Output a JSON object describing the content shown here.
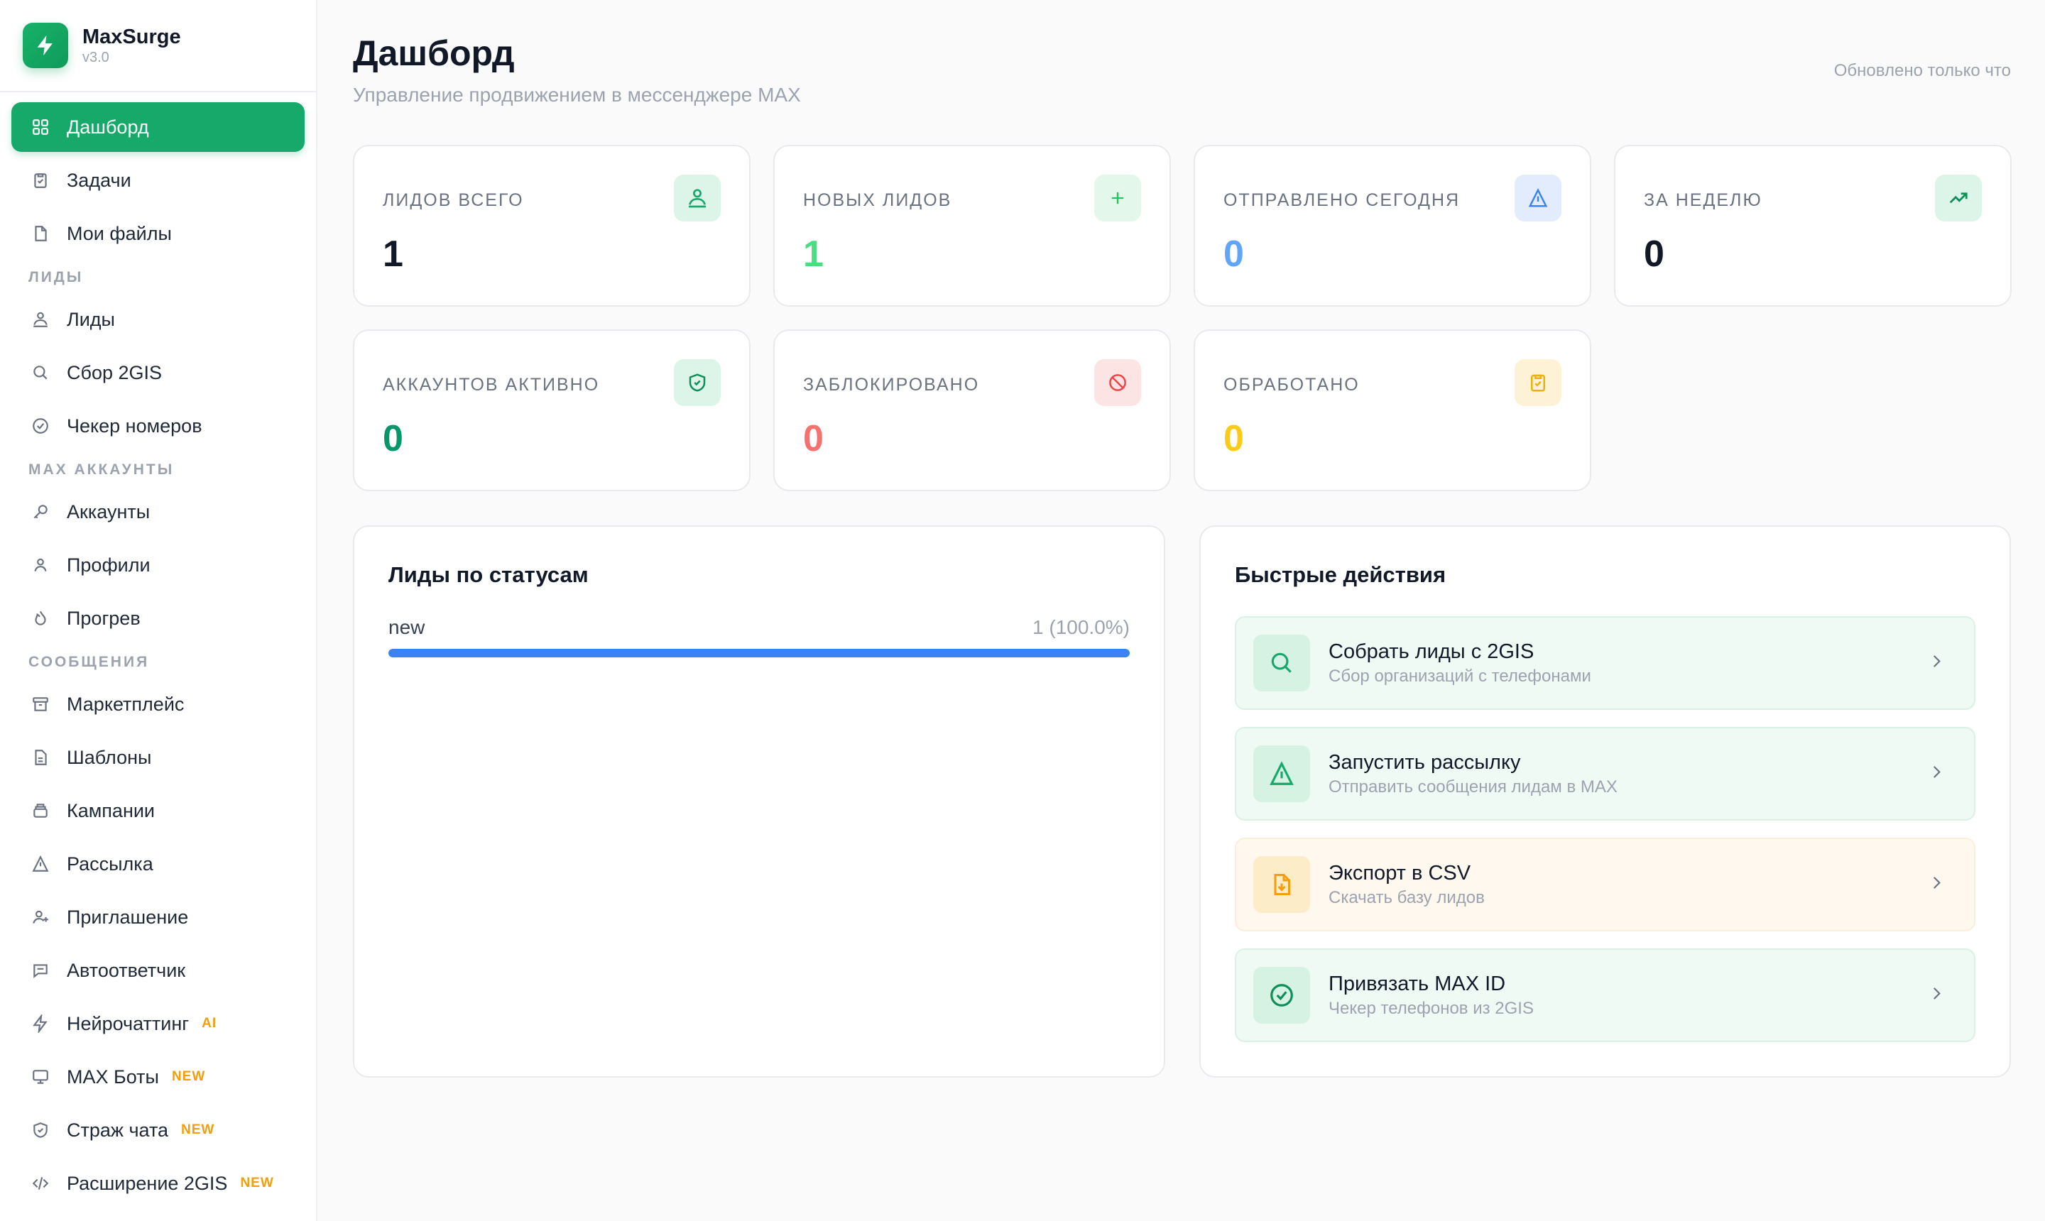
{
  "brand": {
    "name": "MaxSurge",
    "version": "v3.0"
  },
  "sidebar": {
    "items": [
      {
        "label": "Дашборд"
      },
      {
        "label": "Задачи"
      },
      {
        "label": "Мои файлы"
      }
    ],
    "sections": [
      {
        "title": "ЛИДЫ",
        "items": [
          {
            "label": "Лиды"
          },
          {
            "label": "Сбор 2GIS"
          },
          {
            "label": "Чекер номеров"
          }
        ]
      },
      {
        "title": "MAX АККАУНТЫ",
        "items": [
          {
            "label": "Аккаунты"
          },
          {
            "label": "Профили"
          },
          {
            "label": "Прогрев"
          }
        ]
      },
      {
        "title": "СООБЩЕНИЯ",
        "items": [
          {
            "label": "Маркетплейс"
          },
          {
            "label": "Шаблоны"
          },
          {
            "label": "Кампании"
          },
          {
            "label": "Рассылка"
          },
          {
            "label": "Приглашение"
          },
          {
            "label": "Автоответчик"
          },
          {
            "label": "Нейрочаттинг",
            "badge": "AI"
          },
          {
            "label": "MAX Боты",
            "badge": "NEW"
          },
          {
            "label": "Страж чата",
            "badge": "NEW"
          },
          {
            "label": "Расширение 2GIS",
            "badge": "NEW"
          }
        ]
      }
    ]
  },
  "header": {
    "title": "Дашборд",
    "subtitle": "Управление продвижением в мессенджере MAX",
    "updated": "Обновлено только что"
  },
  "stats": [
    {
      "label": "ЛИДОВ ВСЕГО",
      "value": "1",
      "color": "#111827",
      "icon": "users-icon"
    },
    {
      "label": "НОВЫХ ЛИДОВ",
      "value": "1",
      "color": "#4ade80",
      "icon": "plus-icon"
    },
    {
      "label": "ОТПРАВЛЕНО СЕГОДНЯ",
      "value": "0",
      "color": "#60a5fa",
      "icon": "send-icon"
    },
    {
      "label": "ЗА НЕДЕЛЮ",
      "value": "0",
      "color": "#111827",
      "icon": "trending-up-icon"
    },
    {
      "label": "АККАУНТОВ АКТИВНО",
      "value": "0",
      "color": "#059669",
      "icon": "shield-check-icon"
    },
    {
      "label": "ЗАБЛОКИРОВАНО",
      "value": "0",
      "color": "#f87171",
      "icon": "ban-icon"
    },
    {
      "label": "ОБРАБОТАНО",
      "value": "0",
      "color": "#facc15",
      "icon": "clipboard-check-icon"
    }
  ],
  "status_panel": {
    "title": "Лиды по статусам",
    "rows": [
      {
        "name": "new",
        "count_text": "1 (100.0%)",
        "fraction": 1.0
      }
    ]
  },
  "actions_panel": {
    "title": "Быстрые действия",
    "actions": [
      {
        "title": "Собрать лиды с 2GIS",
        "subtitle": "Сбор организаций с телефонами",
        "icon": "search-icon"
      },
      {
        "title": "Запустить рассылку",
        "subtitle": "Отправить сообщения лидам в MAX",
        "icon": "send-icon"
      },
      {
        "title": "Экспорт в CSV",
        "subtitle": "Скачать базу лидов",
        "icon": "file-download-icon"
      },
      {
        "title": "Привязать MAX ID",
        "subtitle": "Чекер телефонов из 2GIS",
        "icon": "check-circle-icon"
      }
    ]
  },
  "colors": {
    "accent": "#16a96a",
    "progress": "#3b82f6",
    "badge": "#f59e0b"
  }
}
